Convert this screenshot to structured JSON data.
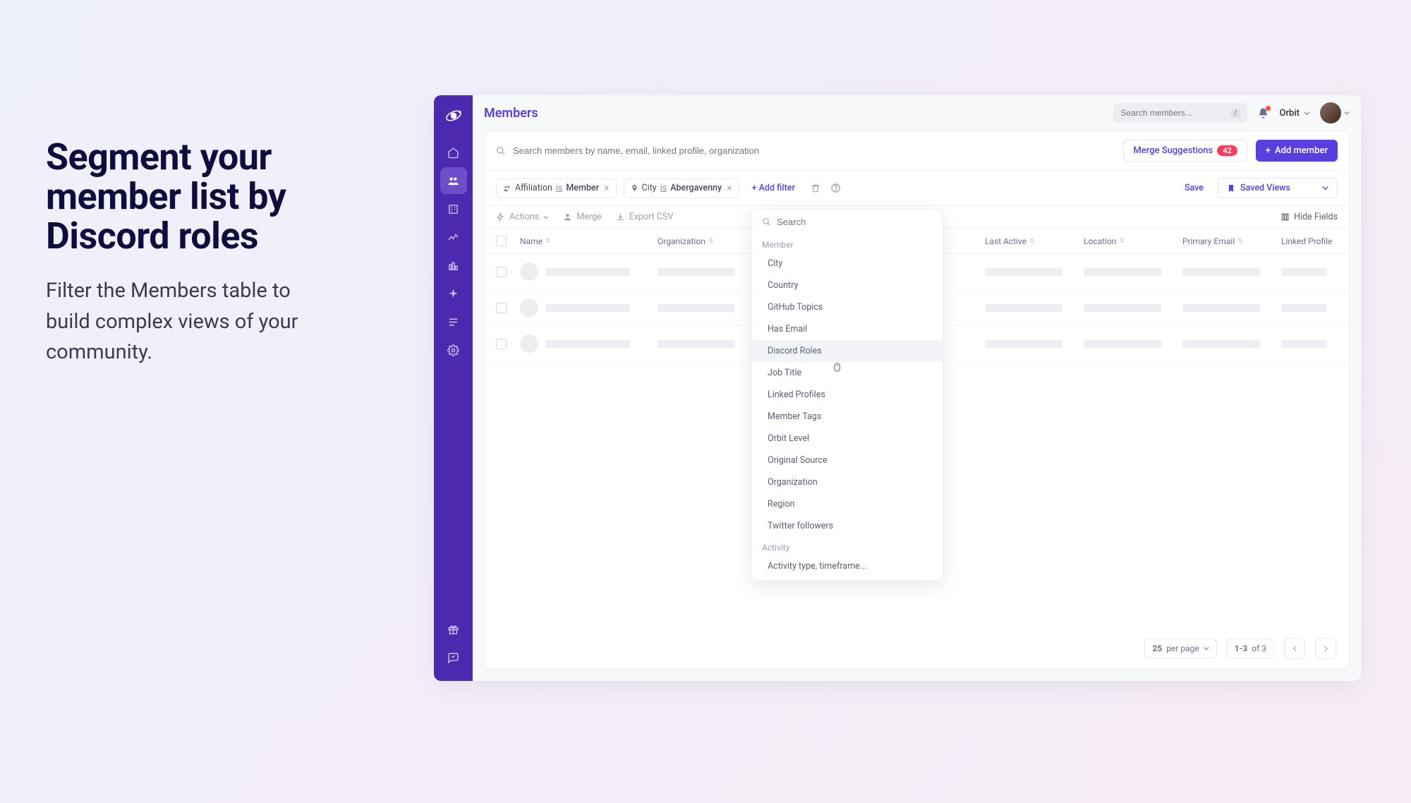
{
  "marketing": {
    "heading": "Segment your member list by Discord roles",
    "subheading": "Filter the Members table to build complex views of your community."
  },
  "topbar": {
    "title": "Members",
    "global_search_placeholder": "Search members...",
    "kbd": "/",
    "workspace": "Orbit"
  },
  "actions": {
    "merge_suggestions": "Merge Suggestions",
    "merge_count": "42",
    "add_member": "Add member"
  },
  "search": {
    "placeholder": "Search members by name, email, linked profile, organization"
  },
  "filters": {
    "chip1_field": "Affiliation",
    "chip1_op": "is",
    "chip1_val": "Member",
    "chip2_field": "City",
    "chip2_op": "is",
    "chip2_val": "Abergavenny",
    "add_filter": "+ Add filter",
    "save": "Save",
    "saved_views": "Saved Views"
  },
  "toolbar": {
    "actions": "Actions",
    "merge": "Merge",
    "export_csv": "Export CSV",
    "hide_fields": "Hide Fields"
  },
  "columns": {
    "name": "Name",
    "organization": "Organization",
    "last_active": "Last Active",
    "location": "Location",
    "primary_email": "Primary Email",
    "linked_profile": "Linked Profile"
  },
  "dropdown": {
    "search_placeholder": "Search",
    "group_member": "Member",
    "items_member": [
      "City",
      "Country",
      "GitHub Topics",
      "Has Email",
      "Discord Roles",
      "Job Title",
      "Linked Profiles",
      "Member Tags",
      "Orbit Level",
      "Original Source",
      "Organization",
      "Region",
      "Twitter followers"
    ],
    "group_activity": "Activity",
    "items_activity": [
      "Activity type, timeframe..."
    ],
    "hover_index": 4
  },
  "pagination": {
    "per_page": "25",
    "per_page_suffix": "per page",
    "range": "1-3",
    "range_suffix": "of 3"
  }
}
